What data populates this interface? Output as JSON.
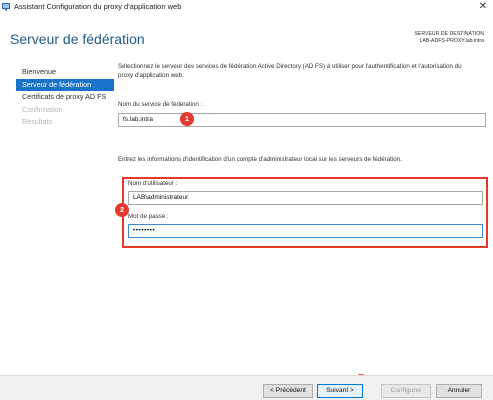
{
  "window": {
    "title": "Assistant Configuration du proxy d'application web",
    "close_glyph": "✕",
    "icon": "app-icon"
  },
  "header": {
    "page_title": "Serveur de fédération",
    "destination_label": "SERVEUR DE DESTINATION",
    "destination_value": "LAB-ADFS-PROXY.lab.intra"
  },
  "nav": {
    "items": [
      {
        "label": "Bienvenue",
        "state": "normal"
      },
      {
        "label": "Serveur de fédération",
        "state": "active"
      },
      {
        "label": "Certificats de proxy AD FS",
        "state": "normal"
      },
      {
        "label": "Confirmation",
        "state": "disabled"
      },
      {
        "label": "Résultats",
        "state": "disabled"
      }
    ]
  },
  "main": {
    "description": "Sélectionnez le serveur des services de fédération Active Directory (AD FS) à utiliser pour l'authentification et l'autorisation du proxy d'application web.",
    "service_name_label": "Nom du service de fédération :",
    "service_name_value": "fs.lab.intra",
    "credentials_info": "Entrez les informations d'identification d'un compte d'administrateur local sur les serveurs de fédération.",
    "username_label": "Nom d'utilisateur :",
    "username_value": "LAB\\administrateur",
    "password_label": "Mot de passe :",
    "password_value": "••••••••"
  },
  "callouts": [
    "1",
    "2",
    "3"
  ],
  "footer": {
    "previous_label": "< Précédent",
    "next_label": "Suivant >",
    "configure_label": "Configurer",
    "cancel_label": "Annuler"
  },
  "colors": {
    "accent": "#1a73c8",
    "title": "#1c5a8c",
    "highlight": "#e5392f"
  }
}
